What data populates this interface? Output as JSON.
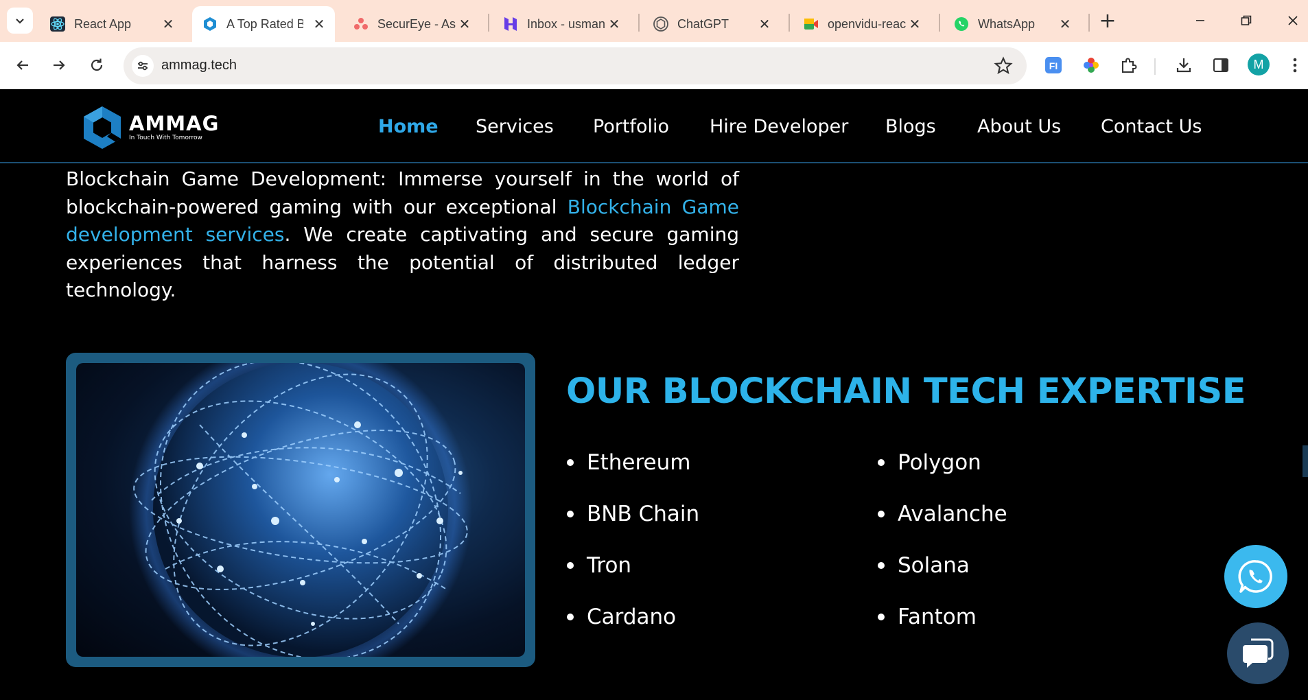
{
  "browser": {
    "tabs": [
      {
        "label": "React App",
        "icon": "react-icon",
        "active": false
      },
      {
        "label": "A Top Rated B",
        "icon": "ammag-favicon",
        "active": true
      },
      {
        "label": "SecurEye - As",
        "icon": "asana-icon",
        "active": false
      },
      {
        "label": "Inbox - usman",
        "icon": "hostinger-mail-icon",
        "active": false
      },
      {
        "label": "ChatGPT",
        "icon": "chatgpt-icon",
        "active": false
      },
      {
        "label": "openvidu-reac",
        "icon": "meet-icon",
        "active": false
      },
      {
        "label": "WhatsApp",
        "icon": "whatsapp-icon",
        "active": false
      }
    ],
    "url": "ammag.tech",
    "profile_initial": "M"
  },
  "site": {
    "logo": {
      "name": "AMMAG",
      "tagline": "In Touch With Tomorrow"
    },
    "nav": [
      "Home",
      "Services",
      "Portfolio",
      "Hire Developer",
      "Blogs",
      "About Us",
      "Contact Us"
    ],
    "nav_active": "Home",
    "paragraph": {
      "lead": "Blockchain Game Development: Immerse yourself in the world of blockchain-powered gaming with our exceptional ",
      "link": "Blockchain Game development services",
      "rest": ". We create captivating and secure gaming experiences that harness the potential of distributed ledger technology."
    },
    "expertise": {
      "title": "OUR BLOCKCHAIN TECH EXPERTISE",
      "left": [
        "Ethereum",
        "BNB Chain",
        "Tron",
        "Cardano"
      ],
      "right": [
        "Polygon",
        "Avalanche",
        "Solana",
        "Fantom"
      ]
    },
    "colors": {
      "accent": "#2db3ea",
      "nav_active": "#2fa8e8",
      "frame": "#1c5b80",
      "background": "#000000"
    }
  }
}
